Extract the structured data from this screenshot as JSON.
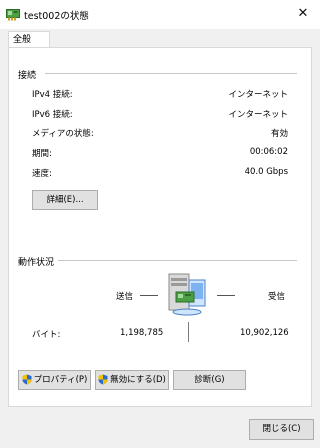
{
  "window": {
    "title": "test002の状態",
    "close_glyph": "✕"
  },
  "tabs": [
    {
      "label": "全般"
    }
  ],
  "connection": {
    "group_title": "接続",
    "rows": [
      {
        "label": "IPv4 接続:",
        "value": "インターネット"
      },
      {
        "label": "IPv6 接続:",
        "value": "インターネット"
      },
      {
        "label": "メディアの状態:",
        "value": "有効"
      },
      {
        "label": "期間:",
        "value": "00:06:02"
      },
      {
        "label": "速度:",
        "value": "40.0 Gbps"
      }
    ],
    "details_button": "詳細(E)..."
  },
  "activity": {
    "group_title": "動作状況",
    "sent_label": "送信",
    "received_label": "受信",
    "bytes_label": "バイト:",
    "bytes_sent": "1,198,785",
    "bytes_received": "10,902,126"
  },
  "buttons": {
    "properties": "プロパティ(P)",
    "disable": "無効にする(D)",
    "diagnose": "診断(G)",
    "close": "閉じる(C)"
  },
  "icons": {
    "title": "network-adapter-icon",
    "activity": "network-computer-icon",
    "shield": "uac-shield-icon"
  },
  "colors": {
    "accent": "#0078d7",
    "shield_blue": "#2a6ad4",
    "shield_yellow": "#f4c400",
    "button_face": "#e1e1e1",
    "button_border": "#adadad"
  }
}
